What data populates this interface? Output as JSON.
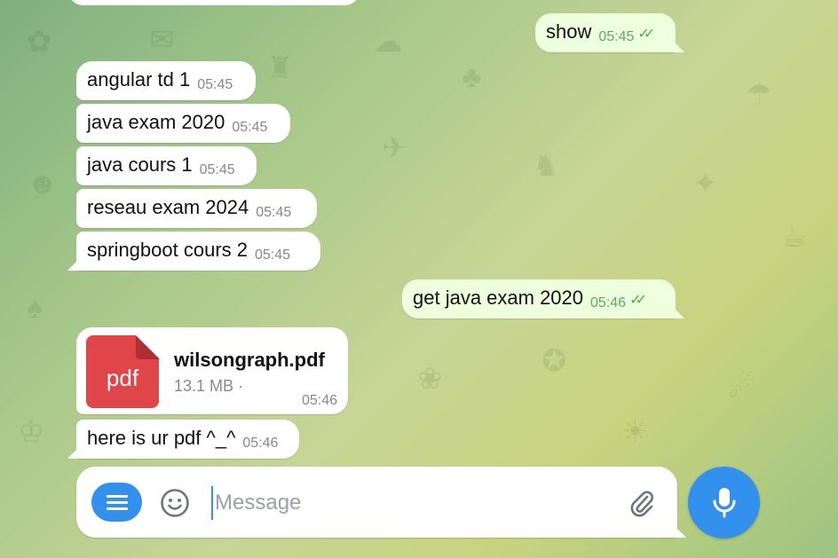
{
  "messages": [
    {
      "text": "show",
      "time": "05:45",
      "dir": "out"
    },
    {
      "text": "angular td 1",
      "time": "05:45",
      "dir": "in"
    },
    {
      "text": "java exam 2020",
      "time": "05:45",
      "dir": "in"
    },
    {
      "text": "java cours 1",
      "time": "05:45",
      "dir": "in"
    },
    {
      "text": "reseau exam 2024",
      "time": "05:45",
      "dir": "in"
    },
    {
      "text": "springboot cours 2",
      "time": "05:45",
      "dir": "in"
    },
    {
      "text": "get java exam 2020",
      "time": "05:46",
      "dir": "out"
    },
    {
      "text": "here is ur pdf ^_^",
      "time": "05:46",
      "dir": "in"
    }
  ],
  "file": {
    "ext": "pdf",
    "name": "wilsongraph.pdf",
    "size": "13.1 MB ·",
    "time": "05:46"
  },
  "composer": {
    "placeholder": "Message"
  },
  "icons": {
    "menu": "menu-icon",
    "emoji": "smile-icon",
    "attach": "paperclip-icon",
    "mic": "microphone-icon",
    "read": "double-check-icon"
  },
  "colors": {
    "accent": "#3390ec",
    "outgoing_bubble": "#eeffde",
    "read_ticks": "#4fae4e",
    "file_icon": "#e0454a"
  }
}
